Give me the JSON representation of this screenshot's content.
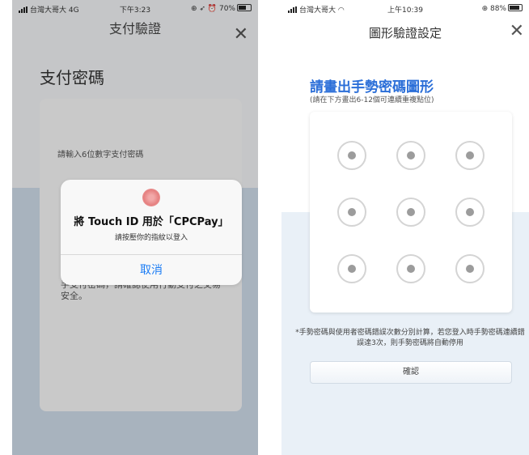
{
  "left": {
    "status": {
      "carrier": "台灣大哥大",
      "network": "4G",
      "time": "下午3:23",
      "battery": "70%"
    },
    "nav_title": "支付驗證",
    "close_glyph": "✕",
    "heading": "支付密碼",
    "pin_prompt": "請輸入6位數字支付密碼",
    "info_text": "手支付密碼，請確認使用行動支付之交易安全。",
    "alert": {
      "title": "將 Touch ID 用於「CPCPay」",
      "message": "請按壓你的指紋以登入",
      "cancel_label": "取消",
      "cancel_color": "#1a7cf5"
    }
  },
  "right": {
    "status": {
      "carrier": "台灣大哥大",
      "time": "上午10:39",
      "battery": "88%"
    },
    "nav_title": "圖形驗證設定",
    "close_glyph": "✕",
    "heading": "請畫出手勢密碼圖形",
    "subheading": "(請在下方畫出6-12個可連續重複點位)",
    "note": "*手勢密碼與使用者密碼錯誤次數分別計算，若您登入時手勢密碼連續錯誤達3次，則手勢密碼將自動停用",
    "confirm_label": "確認",
    "accent_color": "#2a6ed8"
  }
}
